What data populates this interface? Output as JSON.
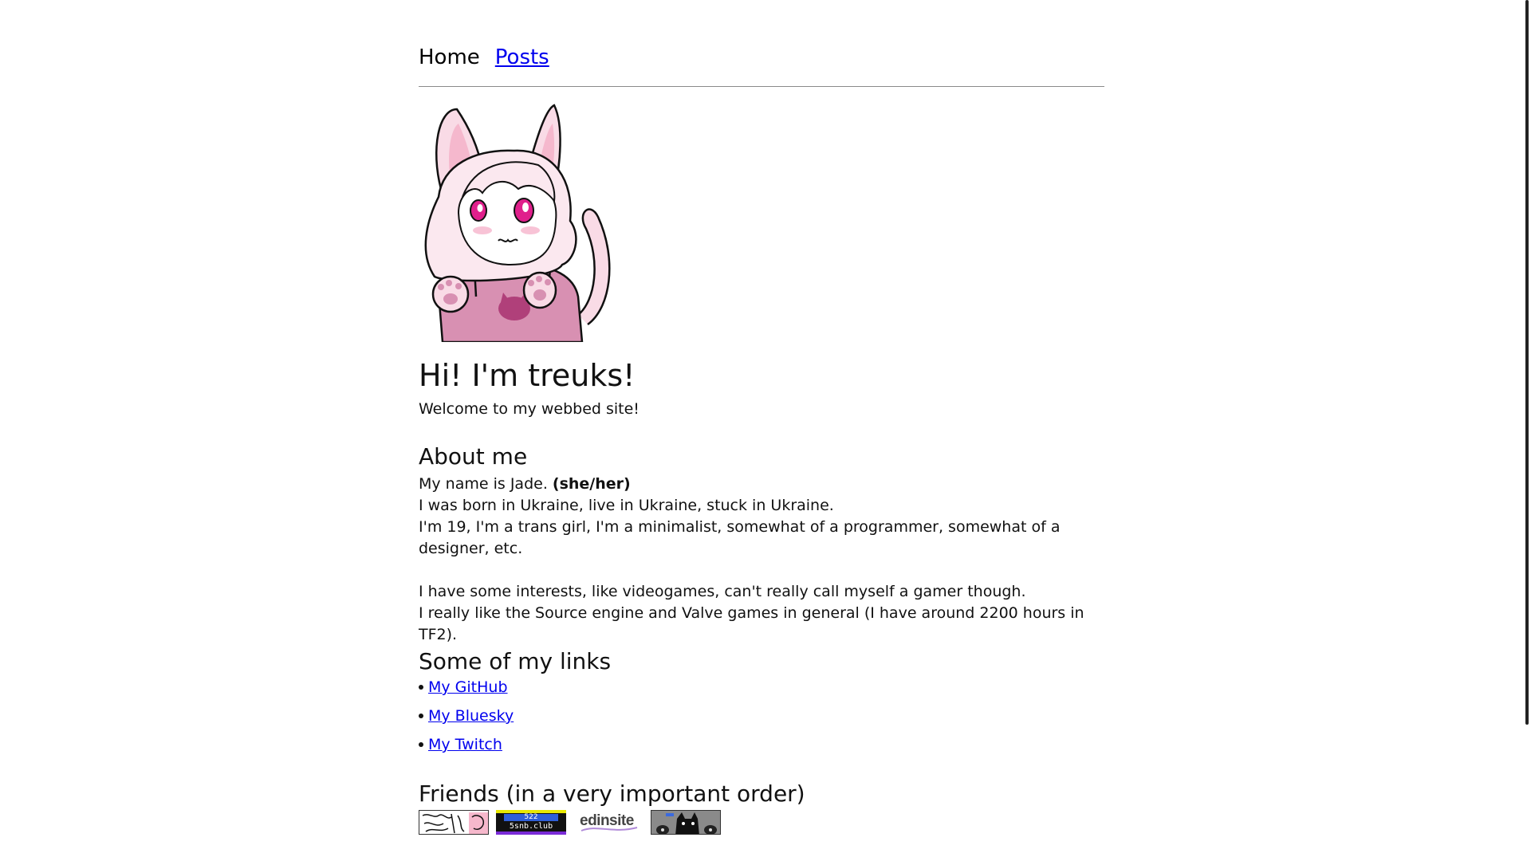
{
  "nav": {
    "home": "Home",
    "posts": "Posts"
  },
  "avatar": {
    "icon": "cat-girl-avatar-icon"
  },
  "hero": {
    "title": "Hi! I'm treuks!",
    "subtitle": "Welcome to my webbed site!"
  },
  "about": {
    "heading": "About me",
    "line1_prefix": "My name is Jade.",
    "line1_bold": "(she/her)",
    "line2": "I was born in Ukraine, live in Ukraine, stuck in Ukraine.",
    "line3": "I'm 19, I'm a trans girl, I'm a minimalist, somewhat of a programmer, somewhat of a designer, etc.",
    "line4": "I have some interests, like videogames, can't really call myself a gamer though.",
    "line5": "I really like the Source engine and Valve games in general (I have around 2200 hours in TF2)."
  },
  "links": {
    "heading": "Some of my links",
    "items": [
      "My GitHub",
      "My Bluesky",
      "My Twitch"
    ]
  },
  "friends": {
    "heading": "Friends (in a very important order)",
    "buttons": [
      {
        "icon": "friend-button-sketch-icon"
      },
      {
        "icon": "friend-button-5snb-icon",
        "text_top": "522",
        "text_bottom": "5snb.club"
      },
      {
        "icon": "friend-button-edinsite-icon",
        "text": "edinsite"
      },
      {
        "icon": "friend-button-cat-icon"
      }
    ]
  },
  "colors": {
    "link": "#0000ee",
    "accent_pink": "#f7c9da",
    "magenta": "#e0208c"
  }
}
